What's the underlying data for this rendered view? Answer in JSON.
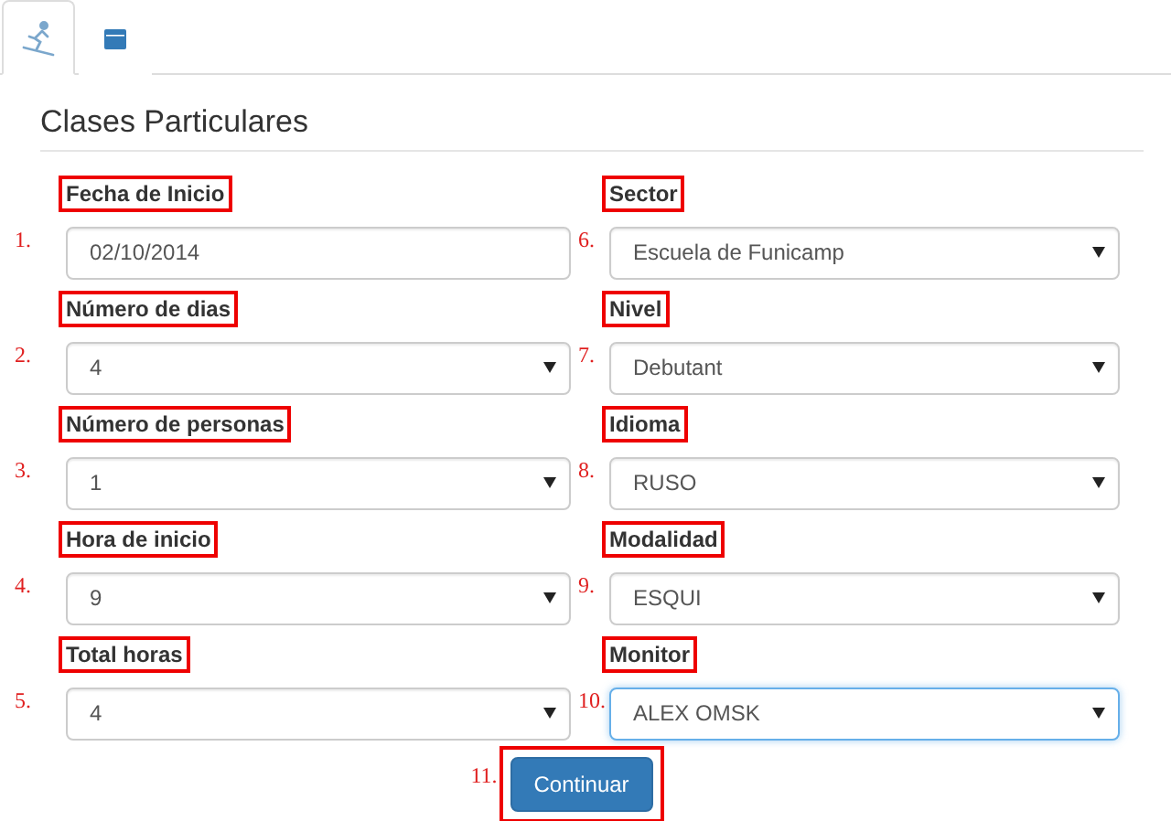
{
  "tabs": [
    {
      "kind": "skier",
      "selected": true
    },
    {
      "kind": "calendar",
      "selected": false
    }
  ],
  "title": "Clases Particulares",
  "columns": [
    [
      {
        "number": "1.",
        "label": "Fecha de Inicio",
        "kind": "date",
        "value": "02/10/2014",
        "focused": false
      },
      {
        "number": "2.",
        "label": "Número de dias",
        "kind": "select",
        "value": "4",
        "focused": false
      },
      {
        "number": "3.",
        "label": "Número de personas",
        "kind": "select",
        "value": "1",
        "focused": false
      },
      {
        "number": "4.",
        "label": "Hora de inicio",
        "kind": "select",
        "value": "9",
        "focused": false
      },
      {
        "number": "5.",
        "label": "Total horas",
        "kind": "select",
        "value": "4",
        "focused": false
      }
    ],
    [
      {
        "number": "6.",
        "label": "Sector",
        "kind": "select",
        "value": "Escuela de Funicamp",
        "focused": false
      },
      {
        "number": "7.",
        "label": "Nivel",
        "kind": "select",
        "value": "Debutant",
        "focused": false
      },
      {
        "number": "8.",
        "label": "Idioma",
        "kind": "select",
        "value": "RUSO",
        "focused": false
      },
      {
        "number": "9.",
        "label": "Modalidad",
        "kind": "select",
        "value": "ESQUI",
        "focused": false
      },
      {
        "number": "10.",
        "label": "Monitor",
        "kind": "select",
        "value": "ALEX OMSK",
        "focused": true
      }
    ]
  ],
  "submit": {
    "number": "11.",
    "label": "Continuar"
  }
}
